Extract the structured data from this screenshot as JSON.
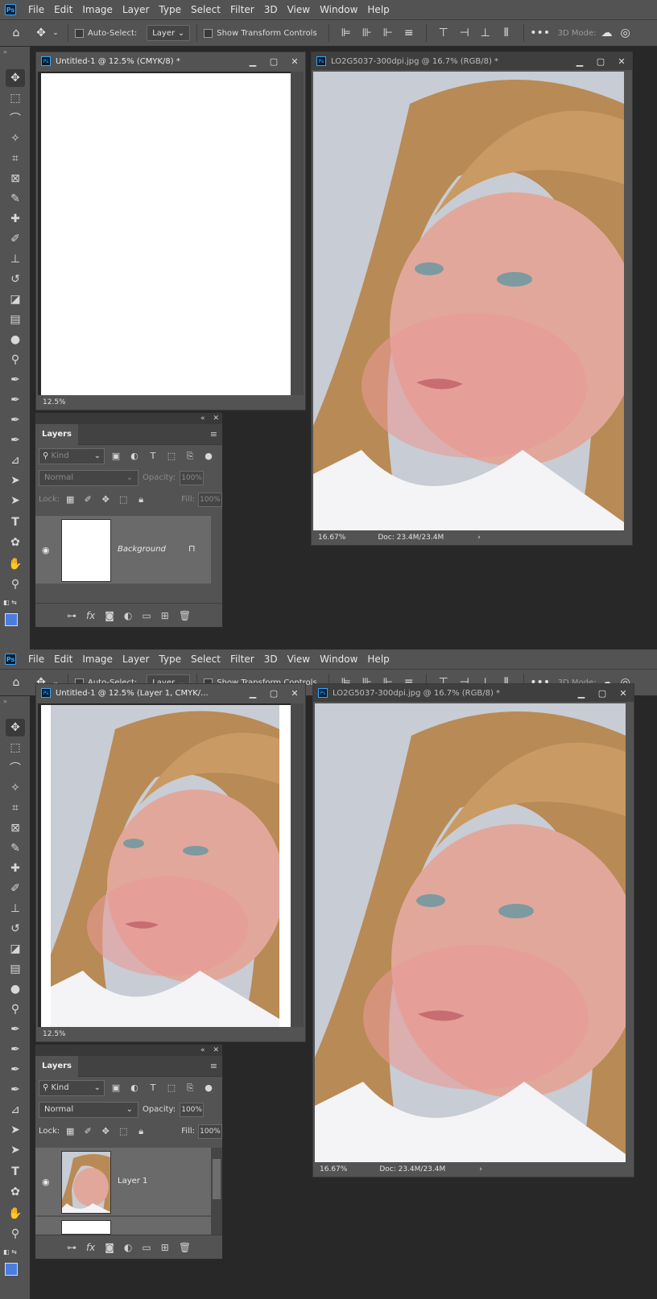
{
  "colors": {
    "panel_bg": "#535353",
    "workspace": "#282828",
    "foreground": "#4a7de0",
    "background": "#ffffff"
  },
  "menu": [
    "File",
    "Edit",
    "Image",
    "Layer",
    "Type",
    "Select",
    "Filter",
    "3D",
    "View",
    "Window",
    "Help"
  ],
  "options": {
    "auto_select": "Auto-Select:",
    "auto_select_target": "Layer",
    "show_transform": "Show Transform Controls",
    "mode_3d": "3D Mode:"
  },
  "top": {
    "doc1_title": "Untitled-1 @ 12.5% (CMYK/8) *",
    "doc1_zoom": "12.5%",
    "doc2_title": "LO2G5037-300dpi.jpg @ 16.7% (RGB/8) *",
    "doc2_zoom": "16.67%",
    "doc2_info": "Doc: 23.4M/23.4M",
    "layers_tab": "Layers",
    "kind": "Kind",
    "blend": "Normal",
    "opacity_label": "Opacity:",
    "opacity": "100%",
    "lock_label": "Lock:",
    "fill_label": "Fill:",
    "fill": "100%",
    "layer_name": "Background"
  },
  "bottom": {
    "doc1_title": "Untitled-1 @ 12.5% (Layer 1, CMYK/...",
    "doc1_zoom": "12.5%",
    "doc2_title": "LO2G5037-300dpi.jpg @ 16.7% (RGB/8) *",
    "doc2_zoom": "16.67%",
    "doc2_info": "Doc: 23.4M/23.4M",
    "layers_tab": "Layers",
    "kind": "Kind",
    "blend": "Normal",
    "opacity_label": "Opacity:",
    "opacity": "100%",
    "lock_label": "Lock:",
    "fill_label": "Fill:",
    "fill": "100%",
    "layer_name": "Layer 1"
  },
  "icons": {
    "home": "home-icon",
    "move": "move-icon",
    "marquee": "marquee-icon",
    "lasso": "lasso-icon",
    "wand": "magic-wand-icon",
    "crop": "crop-icon",
    "frame": "frame-icon",
    "eyedropper": "eyedropper-icon",
    "heal": "healing-brush-icon",
    "brush": "brush-icon",
    "stamp": "clone-stamp-icon",
    "history": "history-brush-icon",
    "eraser": "eraser-icon",
    "gradient": "gradient-icon",
    "blur": "blur-icon",
    "dodge": "dodge-icon",
    "pen": "pen-icon",
    "type": "type-icon",
    "path": "path-selection-icon",
    "shape": "shape-icon",
    "hand": "hand-icon",
    "zoom": "zoom-icon"
  }
}
